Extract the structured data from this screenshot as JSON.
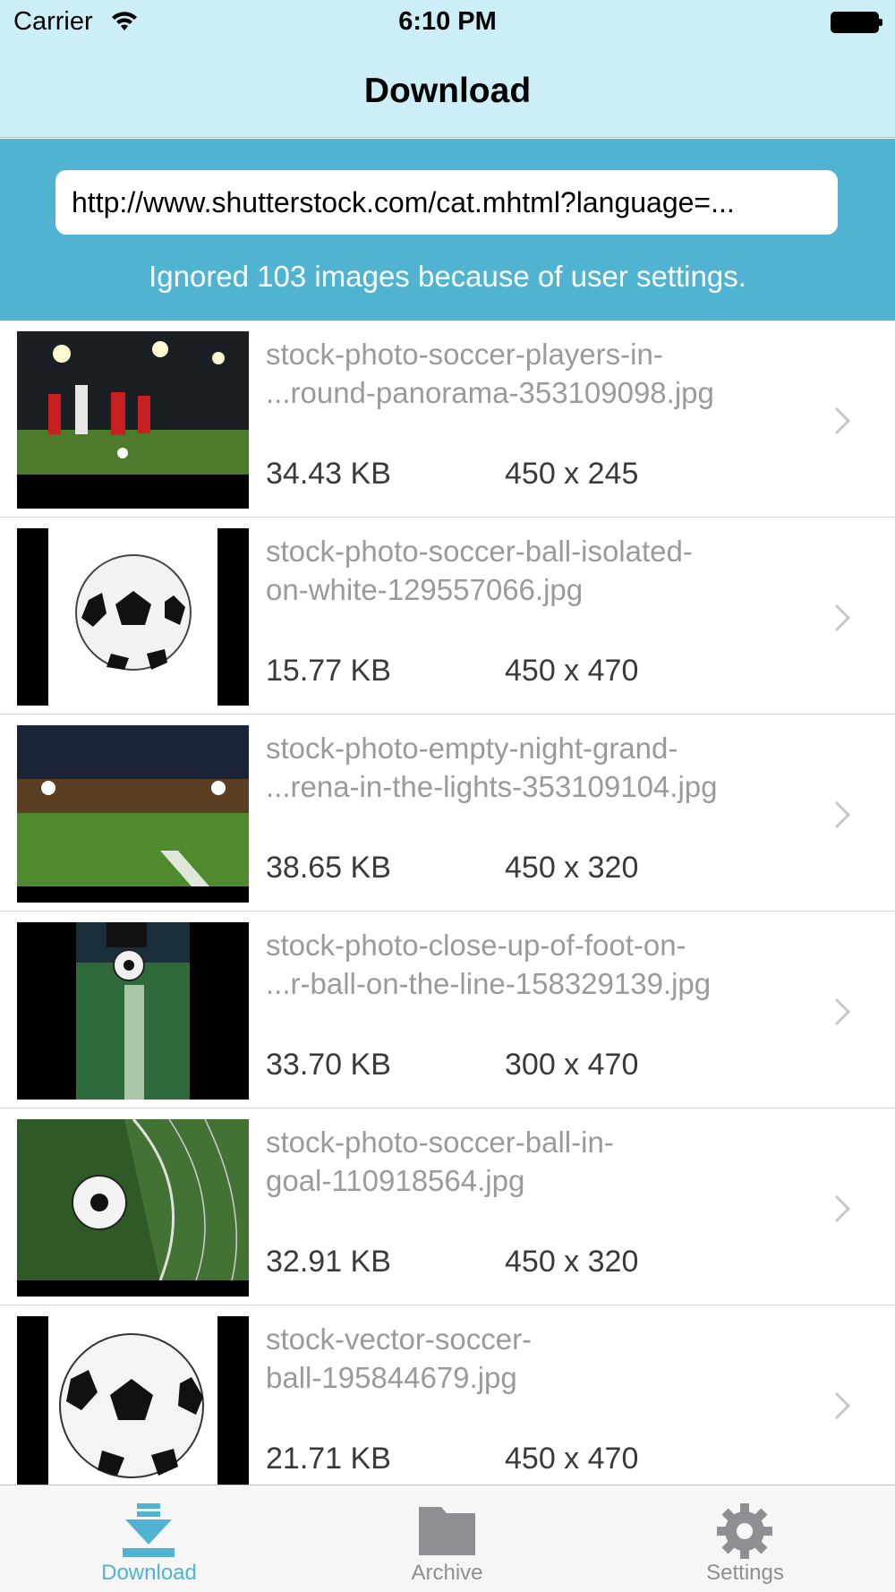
{
  "status_bar": {
    "carrier": "Carrier",
    "time": "6:10 PM",
    "wifi_icon": "wifi-icon",
    "battery_icon": "battery-icon"
  },
  "nav": {
    "title": "Download"
  },
  "url_panel": {
    "url_value": "http://www.shutterstock.com/cat.mhtml?language=...",
    "ignored_message": "Ignored 103 images because of user settings."
  },
  "list": {
    "items": [
      {
        "name": "stock-photo-soccer-players-in-\n...round-panorama-353109098.jpg",
        "size": "34.43 KB",
        "dims": "450 x 245"
      },
      {
        "name": "stock-photo-soccer-ball-isolated-\non-white-129557066.jpg",
        "size": "15.77 KB",
        "dims": "450 x 470"
      },
      {
        "name": "stock-photo-empty-night-grand-\n...rena-in-the-lights-353109104.jpg",
        "size": "38.65 KB",
        "dims": "450 x 320"
      },
      {
        "name": "stock-photo-close-up-of-foot-on-\n...r-ball-on-the-line-158329139.jpg",
        "size": "33.70 KB",
        "dims": "300 x 470"
      },
      {
        "name": "stock-photo-soccer-ball-in-\ngoal-110918564.jpg",
        "size": "32.91 KB",
        "dims": "450 x 320"
      },
      {
        "name": "stock-vector-soccer-\nball-195844679.jpg",
        "size": "21.71 KB",
        "dims": "450 x 470"
      }
    ]
  },
  "tab_bar": {
    "tabs": [
      {
        "label": "Download",
        "icon": "download-icon",
        "active": true
      },
      {
        "label": "Archive",
        "icon": "folder-icon",
        "active": false
      },
      {
        "label": "Settings",
        "icon": "gear-icon",
        "active": false
      }
    ]
  },
  "colors": {
    "nav_background": "#cbeef7",
    "accent": "#4fb3d1",
    "filename_text": "#9a9a9a",
    "meta_text": "#3a3a3a",
    "tab_inactive": "#8e8e93"
  }
}
